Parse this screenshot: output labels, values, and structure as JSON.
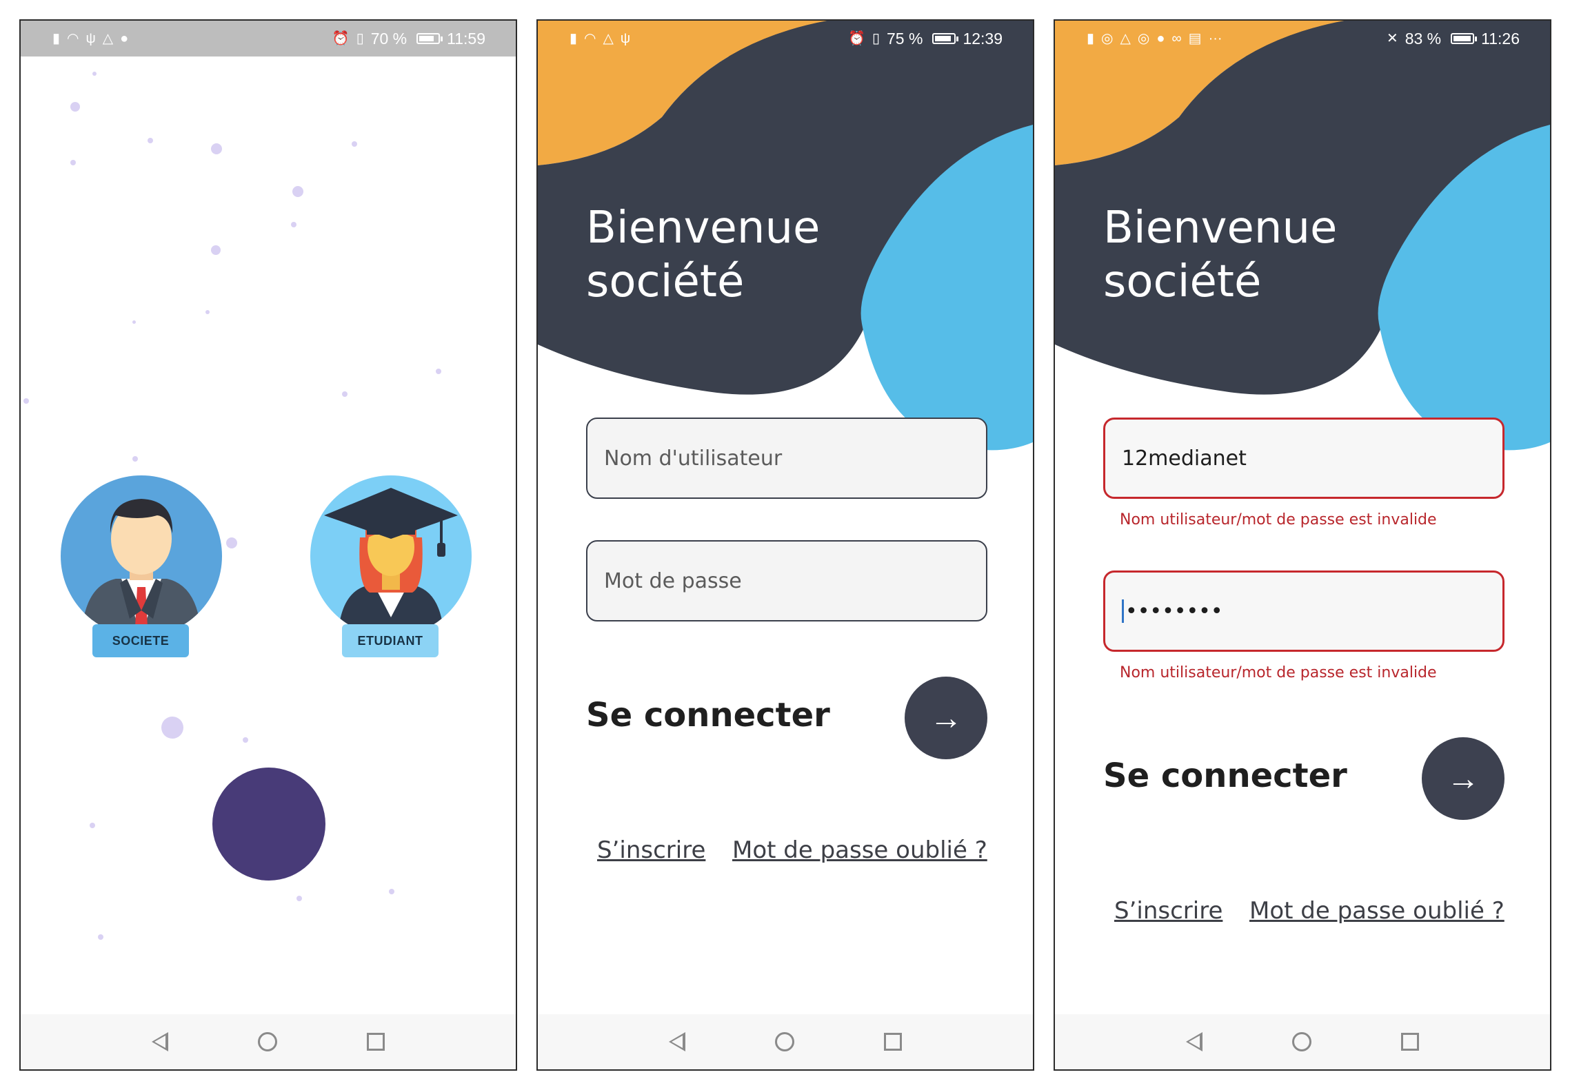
{
  "colors": {
    "dark_blob": "#3a404d",
    "orange_blob": "#f2aa44",
    "blue_blob": "#56bde8",
    "button_bg": "#3d4150",
    "error": "#c6282d",
    "purple_circle": "#483b78"
  },
  "screen1": {
    "status": {
      "battery": "70 %",
      "time": "11:59",
      "battery_level": 0.7
    },
    "roles": [
      {
        "label": "SOCIETE",
        "icon": "businessman-avatar-icon"
      },
      {
        "label": "ETUDIANT",
        "icon": "graduate-avatar-icon"
      }
    ]
  },
  "screen2": {
    "status": {
      "battery": "75 %",
      "time": "12:39",
      "battery_level": 0.75
    },
    "welcome_line1": "Bienvenue",
    "welcome_line2": "société",
    "username_placeholder": "Nom d'utilisateur",
    "password_placeholder": "Mot de passe",
    "connect_label": "Se connecter",
    "signup_link": "S’inscrire",
    "forgot_link": "Mot de passe oublié ?"
  },
  "screen3": {
    "status": {
      "battery": "83 %",
      "time": "11:26",
      "battery_level": 0.83
    },
    "welcome_line1": "Bienvenue",
    "welcome_line2": "société",
    "username_value": "12medianet",
    "username_error": "Nom utilisateur/mot de passe est invalide",
    "password_value": "••••••••",
    "password_error": "Nom utilisateur/mot de passe est invalide",
    "connect_label": "Se connecter",
    "signup_link": "S’inscrire",
    "forgot_link": "Mot de passe oublié ?"
  },
  "nav": {
    "back": "back-icon",
    "home": "home-icon",
    "recents": "recents-icon"
  }
}
